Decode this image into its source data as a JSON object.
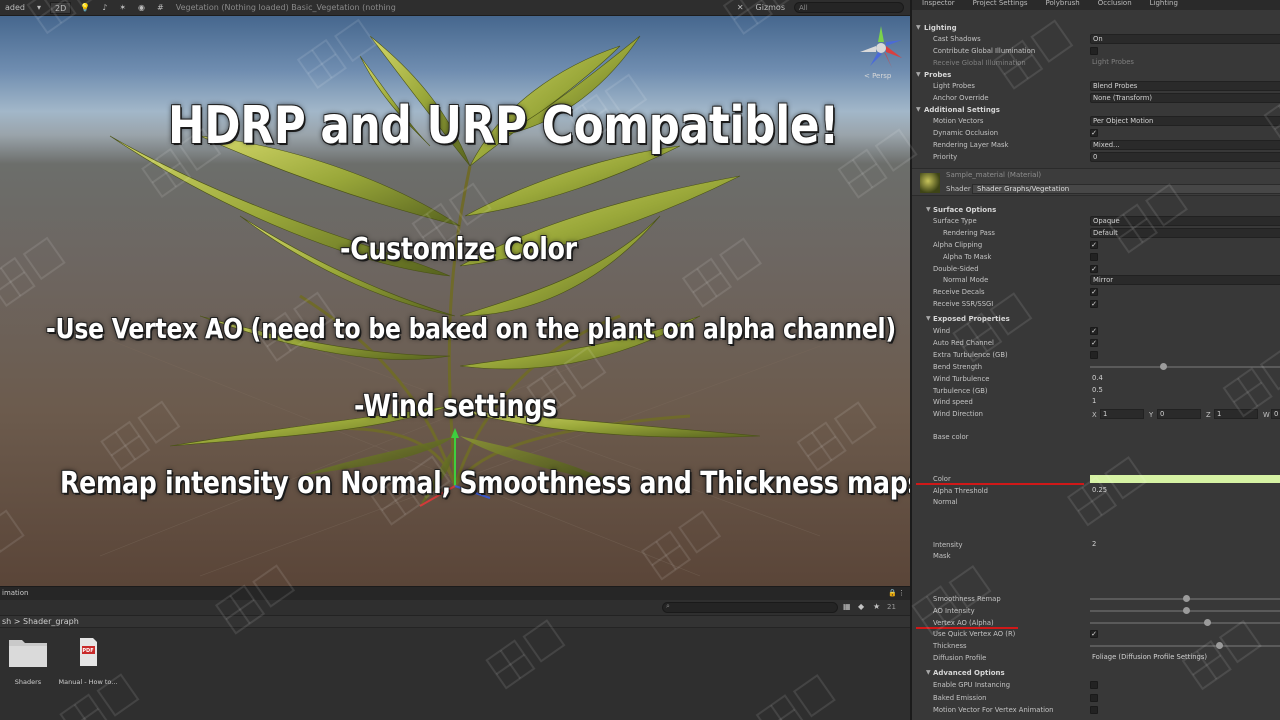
{
  "scene_toolbar": {
    "left_label": "aded",
    "mode_2d": "2D",
    "gizmos_label": "Gizmos",
    "search_placeholder": "All",
    "tab_title": "Vegetation (Nothing loaded)   Basic_Vegetation (nothing"
  },
  "overlay": {
    "headline": "HDRP and URP Compatible!",
    "feature_color": "-Customize Color",
    "feature_ao": "-Use Vertex AO (need to be baked on the plant on alpha channel)",
    "feature_wind": "-Wind settings",
    "feature_remap": "Remap intensity on Normal, Smoothness and Thickness maps"
  },
  "gizmo": {
    "persp_label": "< Persp"
  },
  "project_panel": {
    "tab_label": "imation",
    "count_label": "21",
    "breadcrumb": "sh  >  Shader_graph",
    "assets": [
      {
        "label": "Shaders",
        "icon": "folder-icon"
      },
      {
        "label": "Manual - How to...",
        "icon": "pdf-icon",
        "badge": "PDF"
      }
    ]
  },
  "inspector": {
    "tabs": [
      "Inspector",
      "Project Settings",
      "Polybrush",
      "Occlusion",
      "Lighting"
    ],
    "lighting": {
      "title": "Lighting",
      "cast_shadows": {
        "label": "Cast Shadows",
        "value": "On"
      },
      "contribute_gi": {
        "label": "Contribute Global Illumination"
      },
      "receive_gi": {
        "label": "Receive Global Illumination",
        "value": "Light Probes"
      }
    },
    "probes": {
      "title": "Probes",
      "light_probes": {
        "label": "Light Probes",
        "value": "Blend Probes"
      },
      "anchor_override": {
        "label": "Anchor Override",
        "value": "None (Transform)"
      }
    },
    "additional": {
      "title": "Additional Settings",
      "motion_vectors": {
        "label": "Motion Vectors",
        "value": "Per Object Motion"
      },
      "dynamic_occlusion": {
        "label": "Dynamic Occlusion"
      },
      "rendering_layer_mask": {
        "label": "Rendering Layer Mask",
        "value": "Mixed..."
      },
      "priority": {
        "label": "Priority",
        "value": "0"
      }
    },
    "material": {
      "name": "Sample_material (Material)",
      "shader_label": "Shader",
      "shader_value": "Shader Graphs/Vegetation"
    },
    "surface_options": {
      "title": "Surface Options",
      "surface_type": {
        "label": "Surface Type",
        "value": "Opaque"
      },
      "rendering_pass": {
        "label": "Rendering Pass",
        "value": "Default"
      },
      "alpha_clipping": {
        "label": "Alpha Clipping"
      },
      "alpha_to_mask": {
        "label": "Alpha To Mask"
      },
      "double_sided": {
        "label": "Double-Sided"
      },
      "normal_mode": {
        "label": "Normal Mode",
        "value": "Mirror"
      },
      "receive_decals": {
        "label": "Receive Decals"
      },
      "receive_ssr": {
        "label": "Receive SSR/SSGI"
      }
    },
    "exposed": {
      "title": "Exposed Properties",
      "wind": {
        "label": "Wind"
      },
      "auto_red": {
        "label": "Auto Red Channel"
      },
      "extra_turbulence": {
        "label": "Extra Turbulence (GB)"
      },
      "bend_strength": {
        "label": "Bend Strength",
        "level": 0.38
      },
      "wind_turbulence": {
        "label": "Wind Turbulence",
        "value": "0.4"
      },
      "turbulence_gb": {
        "label": "Turbulence (GB)",
        "value": "0.5"
      },
      "wind_speed": {
        "label": "Wind speed",
        "value": "1"
      },
      "wind_direction": {
        "label": "Wind Direction",
        "x_label": "X",
        "x": "1",
        "y_label": "Y",
        "y": "0",
        "z_label": "Z",
        "z": "1",
        "w_label": "W",
        "w": "0"
      },
      "base_color": {
        "label": "Base color"
      },
      "color": {
        "label": "Color",
        "swatch": "#d6f2a4"
      },
      "alpha_threshold": {
        "label": "Alpha Threshold",
        "value": "0.25"
      },
      "normal": {
        "label": "Normal"
      },
      "intensity": {
        "label": "Intensity",
        "value": "2"
      },
      "mask": {
        "label": "Mask"
      },
      "smoothness_remap": {
        "label": "Smoothness Remap",
        "level": 0.5
      },
      "ao_intensity": {
        "label": "AO Intensity",
        "level": 0.5
      },
      "vertex_ao": {
        "label": "Vertex AO (Alpha)",
        "level": 0.61
      },
      "quick_vertex_ao": {
        "label": "Use Quick Vertex AO (R)"
      },
      "thickness": {
        "label": "Thickness",
        "level": 0.67
      },
      "diffusion_profile": {
        "label": "Diffusion Profile",
        "value": "Foliage (Diffusion Profile Settings)"
      }
    },
    "advanced": {
      "title": "Advanced Options",
      "gpu_instancing": {
        "label": "Enable GPU Instancing"
      },
      "baked_emission": {
        "label": "Baked Emission"
      },
      "motion_vector_vertex": {
        "label": "Motion Vector For Vertex Animation"
      }
    }
  },
  "colors": {
    "accent_red": "#d01818",
    "swatch_color": "#d6f2a4"
  }
}
